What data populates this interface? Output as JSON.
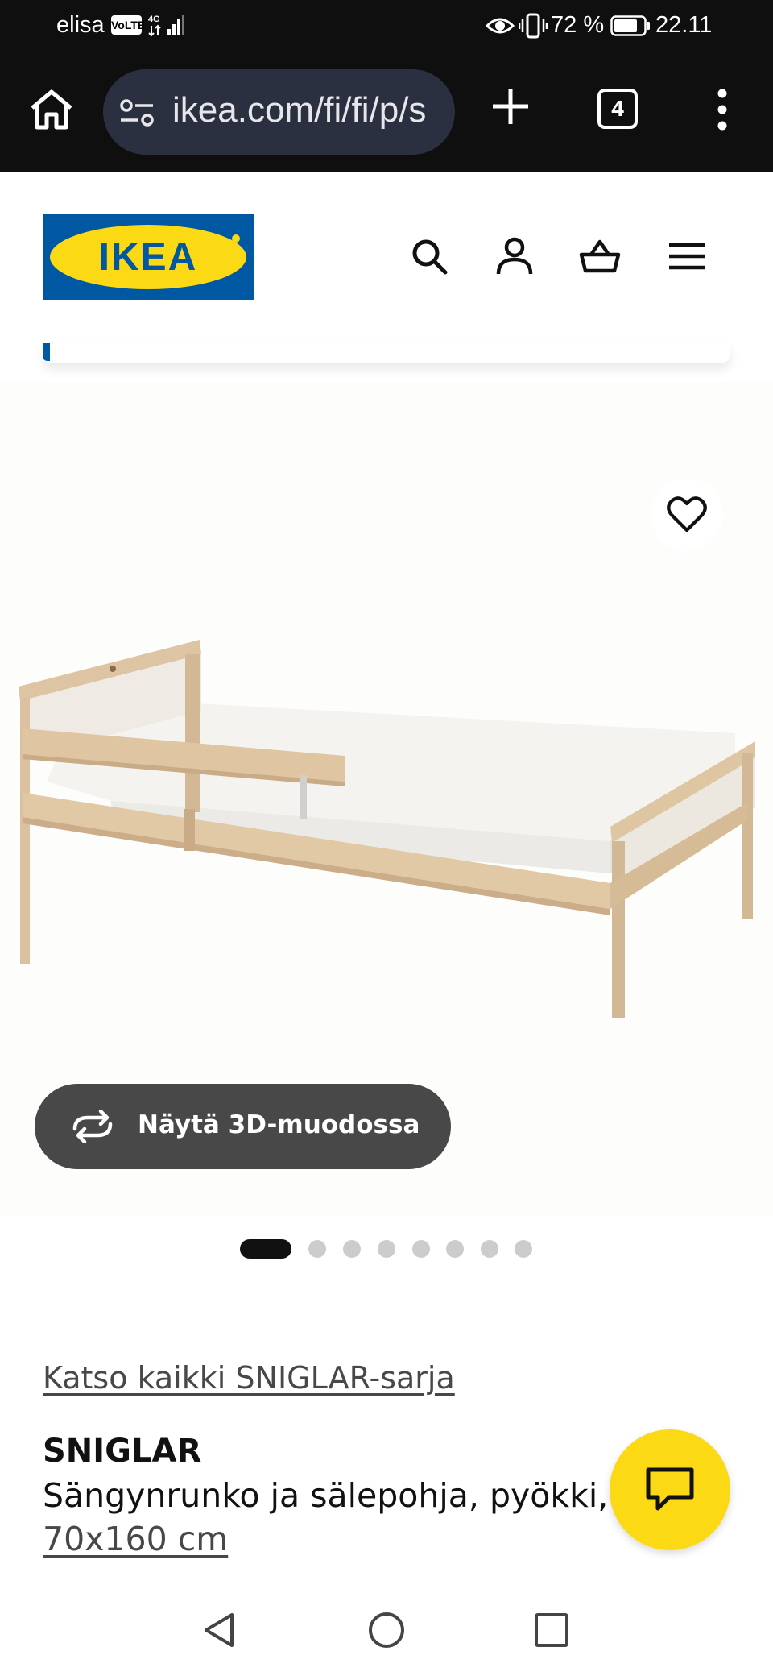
{
  "status_bar": {
    "carrier": "elisa",
    "volte": "VoLTE",
    "battery": "72 %",
    "time": "22.11"
  },
  "browser": {
    "url": "ikea.com/fi/fi/p/s",
    "tab_count": "4"
  },
  "header": {
    "logo": "IKEA",
    "icons": [
      "search-icon",
      "account-icon",
      "basket-icon",
      "menu-icon"
    ]
  },
  "gallery": {
    "view_3d_label": "Näytä 3D-muodossa",
    "image_count": 8,
    "active_image": 1
  },
  "product": {
    "series_link": "Katso kaikki SNIGLAR-sarja",
    "name": "SNIGLAR",
    "description": "Sängynrunko ja sälepohja, pyökki,",
    "size": "70x160 cm"
  },
  "colors": {
    "ikea_blue": "#0058a3",
    "ikea_yellow": "#fbd914",
    "button_dark": "#484848"
  }
}
